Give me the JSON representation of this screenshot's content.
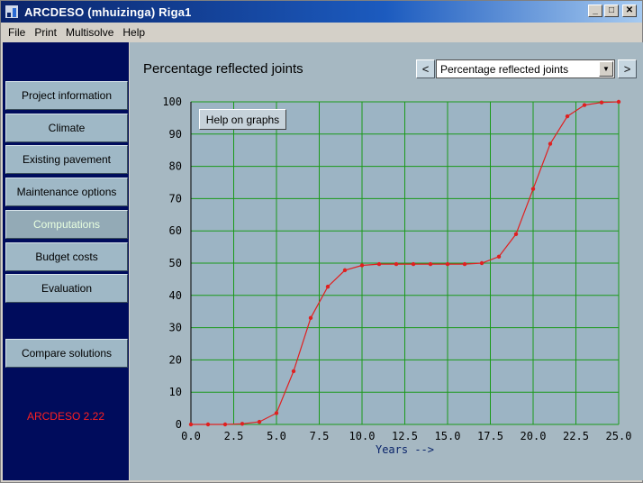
{
  "window": {
    "title": "ARCDESO  (mhuizinga)  Riga1",
    "minimize": "_",
    "maximize": "□",
    "close": "✕"
  },
  "menu": [
    "File",
    "Print",
    "Multisolve",
    "Help"
  ],
  "sidebar": {
    "items": [
      {
        "label": "Project information",
        "active": false
      },
      {
        "label": "Climate",
        "active": false
      },
      {
        "label": "Existing pavement",
        "active": false
      },
      {
        "label": "Maintenance options",
        "active": false
      },
      {
        "label": "Computations",
        "active": true
      },
      {
        "label": "Budget costs",
        "active": false
      },
      {
        "label": "Evaluation",
        "active": false
      }
    ],
    "compare_label": "Compare solutions",
    "version": "ARCDESO 2.22"
  },
  "main": {
    "graph_title": "Percentage reflected joints",
    "prev": "<",
    "next": ">",
    "selected_graph": "Percentage reflected joints",
    "help_button": "Help on graphs"
  },
  "colors": {
    "sidebar_bg": "#000c5c",
    "plot_bg": "#9cb4c4",
    "grid": "#1a9a1a",
    "series": "#e02020",
    "version_text": "#ff2020"
  },
  "chart_data": {
    "type": "line",
    "xlabel": "Years -->",
    "ylabel": "",
    "xlim": [
      0,
      25
    ],
    "ylim": [
      0,
      100
    ],
    "x_ticks": [
      "0.0",
      "2.5",
      "5.0",
      "7.5",
      "10.0",
      "12.5",
      "15.0",
      "17.5",
      "20.0",
      "22.5",
      "25.0"
    ],
    "y_ticks": [
      "0",
      "10",
      "20",
      "30",
      "40",
      "50",
      "60",
      "70",
      "80",
      "90",
      "100"
    ],
    "grid": true,
    "series": [
      {
        "x": [
          0,
          1,
          2,
          3,
          4,
          5,
          6,
          7,
          8,
          9,
          10,
          11,
          12,
          13,
          14,
          15,
          16,
          17,
          18,
          19,
          20,
          21,
          22,
          23,
          24,
          25
        ],
        "y": [
          0,
          0,
          0,
          0.2,
          0.8,
          3.5,
          16.5,
          33,
          42.7,
          47.8,
          49.3,
          49.7,
          49.7,
          49.7,
          49.7,
          49.7,
          49.7,
          50,
          52,
          59,
          73,
          87,
          95.5,
          99,
          99.8,
          100
        ]
      }
    ]
  }
}
